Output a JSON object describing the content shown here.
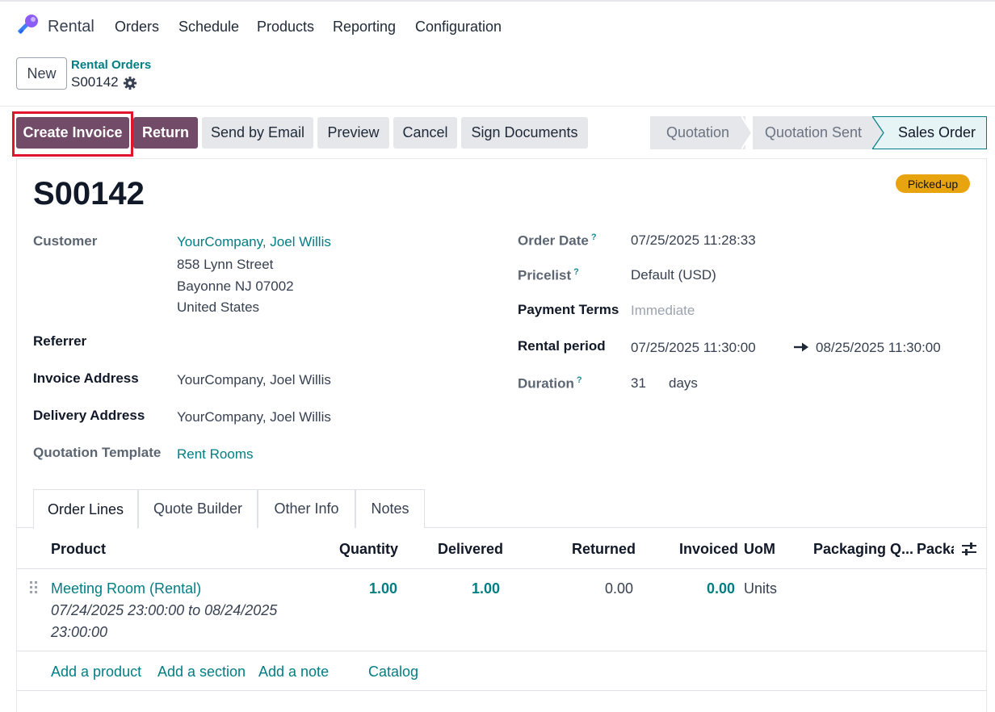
{
  "nav": {
    "app_name": "Rental",
    "items": [
      "Orders",
      "Schedule",
      "Products",
      "Reporting",
      "Configuration"
    ]
  },
  "breadcrumb": {
    "new_label": "New",
    "parent": "Rental Orders",
    "current": "S00142"
  },
  "actions": {
    "create_invoice": "Create Invoice",
    "return": "Return",
    "send_by_email": "Send by Email",
    "preview": "Preview",
    "cancel": "Cancel",
    "sign_documents": "Sign Documents"
  },
  "status_bar": {
    "stages": [
      "Quotation",
      "Quotation Sent",
      "Sales Order"
    ],
    "active": "Sales Order"
  },
  "record": {
    "title": "S00142",
    "badge": "Picked-up",
    "left": {
      "customer_label": "Customer",
      "customer_name": "YourCompany, Joel Willis",
      "address_line1": "858 Lynn Street",
      "address_line2": "Bayonne NJ 07002",
      "address_line3": "United States",
      "referrer_label": "Referrer",
      "invoice_address_label": "Invoice Address",
      "invoice_address": "YourCompany, Joel Willis",
      "delivery_address_label": "Delivery Address",
      "delivery_address": "YourCompany, Joel Willis",
      "quotation_template_label": "Quotation Template",
      "quotation_template": "Rent Rooms"
    },
    "right": {
      "order_date_label": "Order Date",
      "order_date": "07/25/2025 11:28:33",
      "pricelist_label": "Pricelist",
      "pricelist": "Default (USD)",
      "payment_terms_label": "Payment Terms",
      "payment_terms": "Immediate",
      "rental_period_label": "Rental period",
      "rental_start": "07/25/2025 11:30:00",
      "rental_end": "08/25/2025 11:30:00",
      "duration_label": "Duration",
      "duration_value": "31",
      "duration_unit": "days",
      "help_mark": "?"
    }
  },
  "tabs": [
    "Order Lines",
    "Quote Builder",
    "Other Info",
    "Notes"
  ],
  "table": {
    "headers": {
      "product": "Product",
      "quantity": "Quantity",
      "delivered": "Delivered",
      "returned": "Returned",
      "invoiced": "Invoiced",
      "uom": "UoM",
      "packaging_qty": "Packaging Q...",
      "packaging": "Packa"
    },
    "rows": [
      {
        "product": "Meeting Room (Rental)",
        "period_line1": "07/24/2025 23:00:00 to 08/24/2025",
        "period_line2": "23:00:00",
        "quantity": "1.00",
        "delivered": "1.00",
        "returned": "0.00",
        "invoiced": "0.00",
        "uom": "Units"
      }
    ],
    "add_links": {
      "add_product": "Add a product",
      "add_section": "Add a section",
      "add_note": "Add a note",
      "catalog": "Catalog"
    }
  },
  "colors": {
    "primary": "#714b67",
    "link": "#017e84",
    "badge": "#e8a40e",
    "highlight": "#e0142e"
  }
}
